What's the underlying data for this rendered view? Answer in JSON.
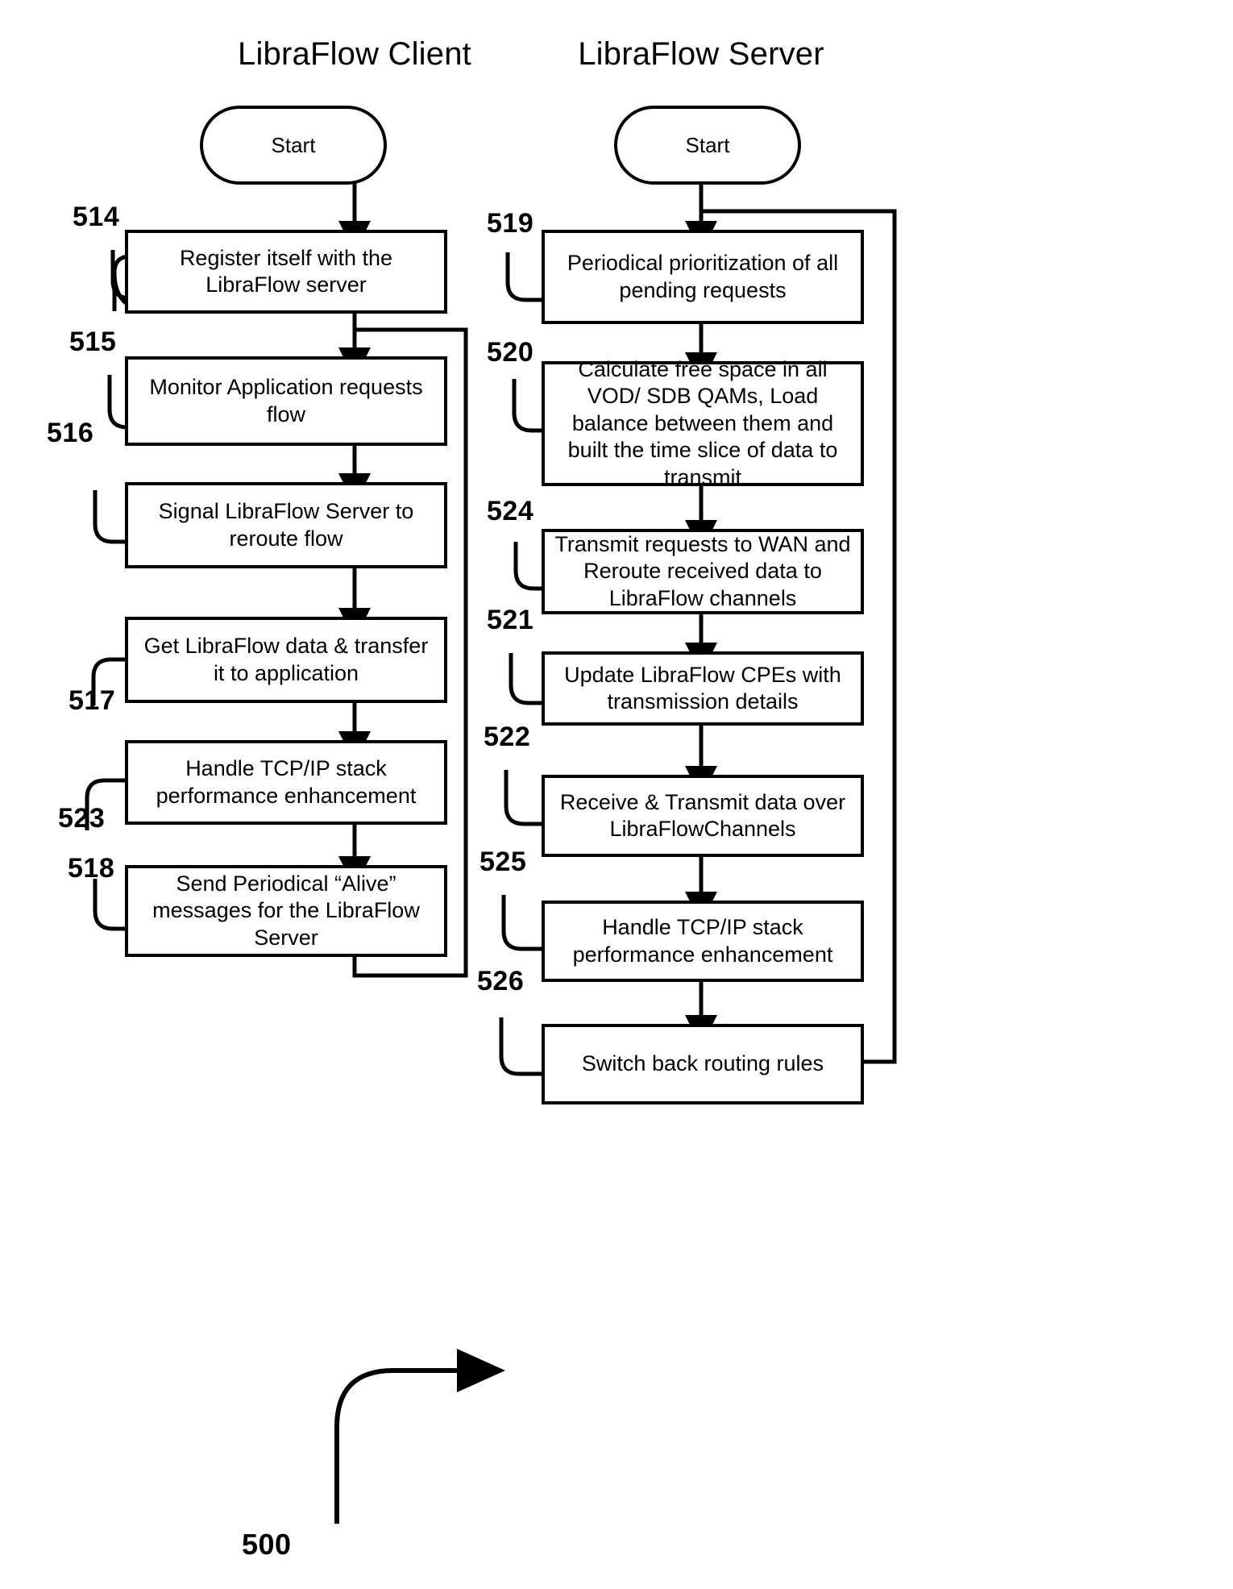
{
  "figure": {
    "number": "500"
  },
  "columns": [
    {
      "title": "LibraFlow Client"
    },
    {
      "title": "LibraFlow Server"
    }
  ],
  "client": {
    "start_label": "Start",
    "steps": [
      {
        "ref": "514",
        "text": "Register itself with the LibraFlow server"
      },
      {
        "ref": "515",
        "text": "Monitor Application requests flow"
      },
      {
        "ref": "516",
        "text": "Signal LibraFlow Server to reroute flow"
      },
      {
        "ref": "517",
        "text": "Get LibraFlow data & transfer it to application"
      },
      {
        "ref": "523",
        "text": "Handle TCP/IP stack performance enhancement"
      },
      {
        "ref": "518",
        "text": "Send Periodical “Alive” messages for the LibraFlow Server"
      }
    ]
  },
  "server": {
    "start_label": "Start",
    "steps": [
      {
        "ref": "519",
        "text": "Periodical prioritization of all pending requests"
      },
      {
        "ref": "520",
        "text": "Calculate free space in all VOD/ SDB QAMs, Load balance between them and  built the time slice of data to transmit"
      },
      {
        "ref": "524",
        "text": "Transmit requests to WAN and Reroute received data to LibraFlow channels"
      },
      {
        "ref": "521",
        "text": "Update LibraFlow CPEs  with transmission details"
      },
      {
        "ref": "522",
        "text": "Receive & Transmit data over LibraFlowChannels"
      },
      {
        "ref": "525",
        "text": "Handle TCP/IP stack performance enhancement"
      },
      {
        "ref": "526",
        "text": "Switch back routing rules"
      }
    ]
  },
  "colors": {
    "ink": "#000000",
    "paper": "#ffffff"
  }
}
